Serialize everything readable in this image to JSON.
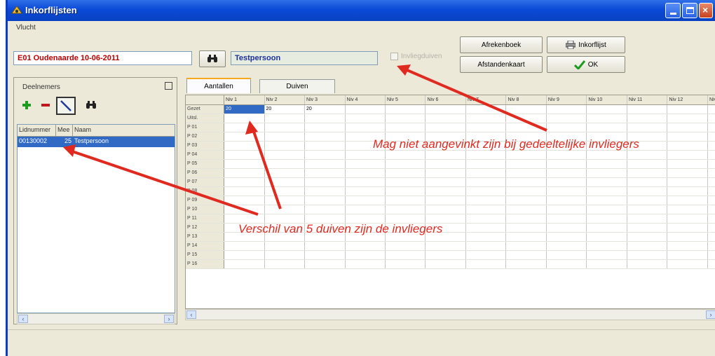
{
  "window": {
    "title": "Inkorflijsten"
  },
  "flight": {
    "label": "Vlucht",
    "value": "E01 Oudenaarde 10-06-2011",
    "person": "Testpersoon"
  },
  "checkbox": {
    "label": "Invliegduiven",
    "checked": false
  },
  "buttons": {
    "afrekenboek": "Afrekenboek",
    "inkorflijst": "Inkorflijst",
    "afstandenkaart": "Afstandenkaart",
    "ok": "OK"
  },
  "participants": {
    "title": "Deelnemers",
    "columns": [
      "Lidnummer",
      "Mee",
      "Naam"
    ],
    "rows": [
      {
        "lidnummer": "00130002",
        "mee": "25",
        "naam": "Testpersoon"
      }
    ]
  },
  "tabs": [
    "Aantallen",
    "Duiven"
  ],
  "grid": {
    "columns": [
      "Niv 1",
      "Niv 2",
      "Niv 3",
      "Niv 4",
      "Niv 5",
      "Niv 6",
      "Niv 7",
      "Niv 8",
      "Niv 9",
      "Niv 10",
      "Niv 11",
      "Niv 12",
      "Niv"
    ],
    "rows": [
      {
        "label": "Gezet",
        "values": [
          "20",
          "20",
          "20"
        ]
      },
      {
        "label": "Uitsl.",
        "values": []
      },
      {
        "label": "P 01",
        "values": []
      },
      {
        "label": "P 02",
        "values": []
      },
      {
        "label": "P 03",
        "values": []
      },
      {
        "label": "P 04",
        "values": []
      },
      {
        "label": "P 05",
        "values": []
      },
      {
        "label": "P 06",
        "values": []
      },
      {
        "label": "P 07",
        "values": []
      },
      {
        "label": "P 08",
        "values": []
      },
      {
        "label": "P 09",
        "values": []
      },
      {
        "label": "P 10",
        "values": []
      },
      {
        "label": "P 11",
        "values": []
      },
      {
        "label": "P 12",
        "values": []
      },
      {
        "label": "P 13",
        "values": []
      },
      {
        "label": "P 14",
        "values": []
      },
      {
        "label": "P 15",
        "values": []
      },
      {
        "label": "P 16",
        "values": []
      }
    ]
  },
  "annotations": {
    "note1": "Mag niet aangevinkt zijn bij gedeeltelijke invliegers",
    "note2": "Verschil van 5 duiven zijn de invliegers",
    "color": "#e02a20"
  },
  "colors": {
    "titlebar": "#0a4ad6",
    "selection": "#316ac5",
    "flight_text": "#c00000",
    "person_text": "#1d2f9a",
    "ok_check": "#1e9a1e"
  }
}
